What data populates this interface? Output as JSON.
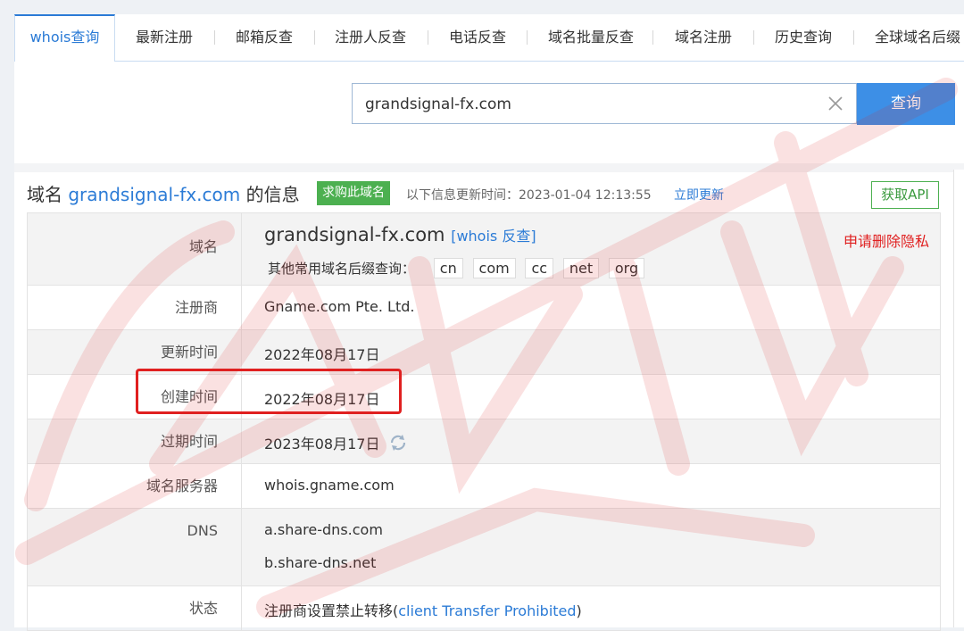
{
  "tabs": [
    {
      "label": "whois查询",
      "active": true
    },
    {
      "label": "最新注册"
    },
    {
      "label": "邮箱反查"
    },
    {
      "label": "注册人反查"
    },
    {
      "label": "电话反查"
    },
    {
      "label": "域名批量反查"
    },
    {
      "label": "域名注册"
    },
    {
      "label": "历史查询"
    },
    {
      "label": "全球域名后缀"
    }
  ],
  "search": {
    "value": "grandsignal-fx.com",
    "button_label": "查询",
    "clear_icon": "close-icon"
  },
  "header": {
    "title_prefix": "域名",
    "domain": "grandsignal-fx.com",
    "title_suffix": "的信息",
    "buy_badge": "求购此域名",
    "update_label": "以下信息更新时间：2023-01-04 12:13:55",
    "update_link": "立即更新",
    "api_button": "获取API"
  },
  "rows": {
    "domain": {
      "label": "域名",
      "value": "grandsignal-fx.com",
      "reverse_link": "[whois 反查]",
      "privacy_link": "申请删除隐私",
      "suffix_label": "其他常用域名后缀查询：",
      "suffixes": [
        "cn",
        "com",
        "cc",
        "net",
        "org"
      ]
    },
    "registrar": {
      "label": "注册商",
      "value": "Gname.com Pte. Ltd."
    },
    "updated": {
      "label": "更新时间",
      "value": "2022年08月17日"
    },
    "created": {
      "label": "创建时间",
      "value": "2022年08月17日"
    },
    "expires": {
      "label": "过期时间",
      "value": "2023年08月17日",
      "icon": "refresh-icon"
    },
    "whois_server": {
      "label": "域名服务器",
      "value": "whois.gname.com"
    },
    "dns": {
      "label": "DNS",
      "values": [
        "a.share-dns.com",
        "b.share-dns.net"
      ]
    },
    "status": {
      "label": "状态",
      "prefix": "注册商设置禁止转移(",
      "link": "client Transfer Prohibited",
      "suffix": ")"
    }
  },
  "colors": {
    "accent": "#2b7bd6",
    "button": "#3d8fe6",
    "badge": "#4cb050",
    "highlight": "#e02020"
  }
}
